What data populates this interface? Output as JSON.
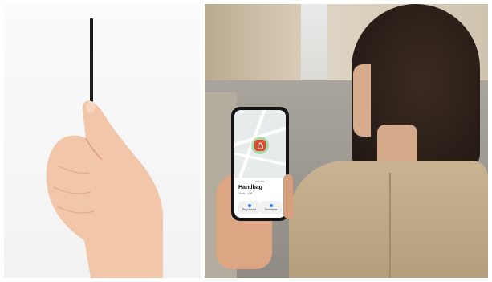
{
  "left_photo": {
    "subject": "hand holding thin black tracker card edge-on"
  },
  "right_photo": {
    "subject": "woman holding phone on city street",
    "phone": {
      "item_title": "Handbag",
      "item_sub": "Now · 0 ft",
      "actions": [
        {
          "label": "Play sound"
        },
        {
          "label": "Directions"
        }
      ]
    }
  },
  "colors": {
    "pin_bg": "#e0472f",
    "pin_ring": "#5abe5a",
    "jacket": "#c9b392",
    "hair": "#2a1f18"
  }
}
